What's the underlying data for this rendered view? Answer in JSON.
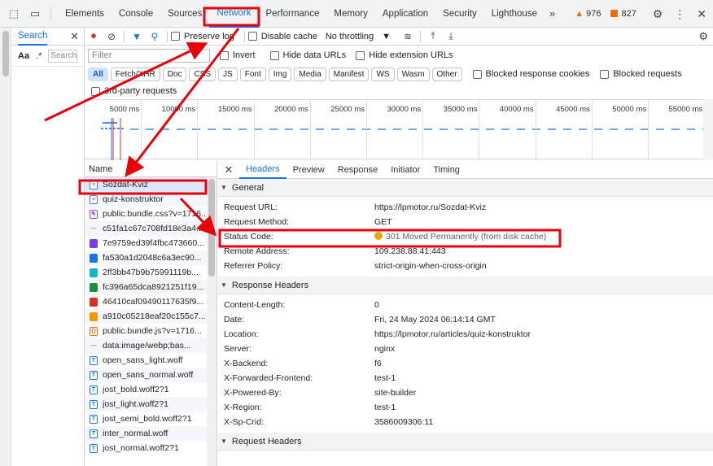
{
  "topbar": {
    "tabs": [
      "Elements",
      "Console",
      "Sources",
      "Network",
      "Performance",
      "Memory",
      "Application",
      "Security",
      "Lighthouse"
    ],
    "active_tab": "Network",
    "more_label": "»",
    "warnings": "976",
    "issues": "827"
  },
  "search": {
    "title": "Search",
    "aa": "Aa",
    "regex": ".*",
    "placeholder": "Search"
  },
  "toolbar": {
    "preserve_log": "Preserve log",
    "disable_cache": "Disable cache",
    "throttling": "No throttling"
  },
  "filter": {
    "placeholder": "Filter",
    "invert": "Invert",
    "hide_data": "Hide data URLs",
    "hide_ext": "Hide extension URLs"
  },
  "types": [
    "All",
    "Fetch/XHR",
    "Doc",
    "CSS",
    "JS",
    "Font",
    "Img",
    "Media",
    "Manifest",
    "WS",
    "Wasm",
    "Other"
  ],
  "type_checks": {
    "blocked_cookies": "Blocked response cookies",
    "blocked_requests": "Blocked requests",
    "third_party": "3rd-party requests"
  },
  "timeline": {
    "ticks": [
      "5000 ms",
      "10000 ms",
      "15000 ms",
      "20000 ms",
      "25000 ms",
      "30000 ms",
      "35000 ms",
      "40000 ms",
      "45000 ms",
      "50000 ms",
      "55000 ms"
    ]
  },
  "requests": {
    "header": "Name",
    "items": [
      {
        "name": "Sozdat-Kviz",
        "type": "doc"
      },
      {
        "name": "quiz-konstruktor",
        "type": "doc"
      },
      {
        "name": "public.bundle.css?v=1716...",
        "type": "css"
      },
      {
        "name": "c51fa1c67c708fd18e3a4...",
        "type": "other"
      },
      {
        "name": "7e9759ed39f4fbc473660...",
        "type": "img-purple"
      },
      {
        "name": "fa530a1d2048c6a3ec90...",
        "type": "img-blue"
      },
      {
        "name": "2ff3bb47b9b75991119b...",
        "type": "img-teal"
      },
      {
        "name": "fc396a65dca8921251f19...",
        "type": "img-green"
      },
      {
        "name": "46410caf09490117635f9...",
        "type": "img-red"
      },
      {
        "name": "a910c05218eaf20c155c7...",
        "type": "img-orange"
      },
      {
        "name": "public.bundle.js?v=1716...",
        "type": "js"
      },
      {
        "name": "data:image/webp;bas...",
        "type": "other"
      },
      {
        "name": "open_sans_light.woff",
        "type": "font"
      },
      {
        "name": "open_sans_normal.woff",
        "type": "font"
      },
      {
        "name": "jost_bold.woff2?1",
        "type": "font"
      },
      {
        "name": "jost_light.woff2?1",
        "type": "font"
      },
      {
        "name": "jost_semi_bold.woff2?1",
        "type": "font"
      },
      {
        "name": "inter_normal.woff",
        "type": "font"
      },
      {
        "name": "jost_normal.woff2?1",
        "type": "font"
      }
    ]
  },
  "detail": {
    "tabs": [
      "Headers",
      "Preview",
      "Response",
      "Initiator",
      "Timing"
    ],
    "active_tab": "Headers",
    "general_title": "General",
    "general": [
      {
        "key": "Request URL:",
        "value": "https://lpmotor.ru/Sozdat-Kviz"
      },
      {
        "key": "Request Method:",
        "value": "GET"
      },
      {
        "key": "Status Code:",
        "value": "301 Moved Permanently (from disk cache)"
      },
      {
        "key": "Remote Address:",
        "value": "109.238.88.41:443"
      },
      {
        "key": "Referrer Policy:",
        "value": "strict-origin-when-cross-origin"
      }
    ],
    "response_title": "Response Headers",
    "response": [
      {
        "key": "Content-Length:",
        "value": "0"
      },
      {
        "key": "Date:",
        "value": "Fri, 24 May 2024 06:14:14 GMT"
      },
      {
        "key": "Location:",
        "value": "https://lpmotor.ru/articles/quiz-konstruktor"
      },
      {
        "key": "Server:",
        "value": "nginx"
      },
      {
        "key": "X-Backend:",
        "value": "f6"
      },
      {
        "key": "X-Forwarded-Frontend:",
        "value": "test-1"
      },
      {
        "key": "X-Powered-By:",
        "value": "site-builder"
      },
      {
        "key": "X-Region:",
        "value": "test-1"
      },
      {
        "key": "X-Sp-Crid:",
        "value": "3586009306:11"
      }
    ],
    "request_title": "Request Headers"
  },
  "colors": {
    "accent": "#1a73e8",
    "annotation": "#e8000b",
    "warning": "#e8710a"
  }
}
